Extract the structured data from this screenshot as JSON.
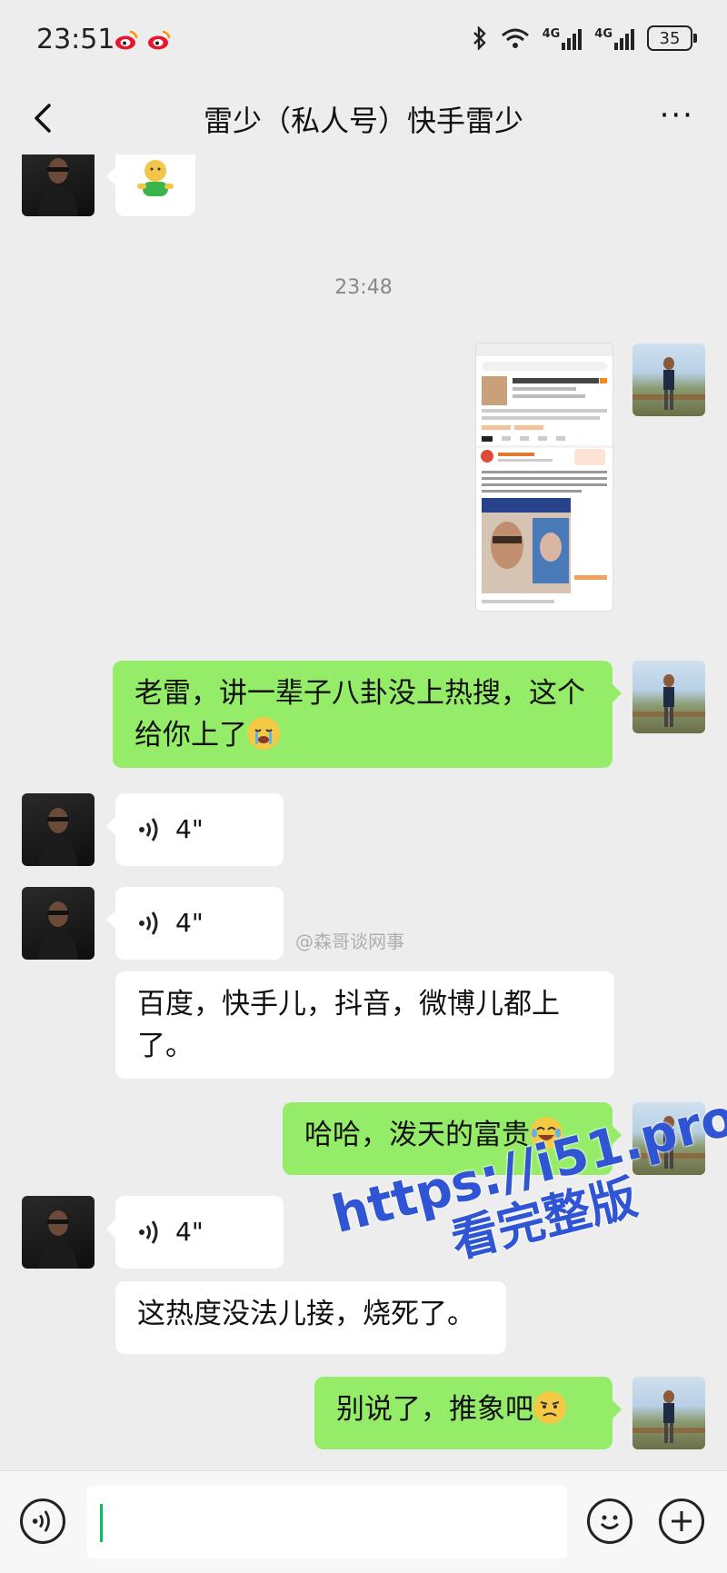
{
  "status_bar": {
    "time": "23:51",
    "network_1": "4G",
    "network_2": "4G",
    "battery": "35"
  },
  "header": {
    "title": "雷少（私人号）快手雷少",
    "more_label": "···"
  },
  "chat": {
    "timestamp": "23:48",
    "messages": [
      {
        "side": "left",
        "type": "emoji"
      },
      {
        "side": "right",
        "type": "image"
      },
      {
        "side": "right",
        "type": "text",
        "text": "老雷，讲一辈子八卦没上热搜，这个给你上了"
      },
      {
        "side": "left",
        "type": "voice",
        "duration": "4\""
      },
      {
        "side": "left",
        "type": "voice",
        "duration": "4\""
      },
      {
        "side": "left",
        "type": "text",
        "text": "百度，快手儿，抖音，微博儿都上了。"
      },
      {
        "side": "right",
        "type": "text",
        "text": "哈哈，泼天的富贵"
      },
      {
        "side": "left",
        "type": "voice",
        "duration": "4\""
      },
      {
        "side": "left",
        "type": "text",
        "text": "这热度没法儿接，烧死了。"
      },
      {
        "side": "right",
        "type": "text",
        "text": "别说了，推象吧"
      }
    ],
    "watermark": "@森哥谈网事",
    "promo_line1": "https://i51.pro",
    "promo_line2": "看完整版"
  },
  "input_bar": {
    "voice_icon": "voice-mode-icon",
    "emoji_icon": "emoji-icon",
    "add_icon": "plus-icon"
  },
  "colors": {
    "chat_bg": "#ededed",
    "bubble_self": "#95ec69",
    "bubble_other": "#ffffff",
    "accent": "#07c160",
    "promo": "#2f55d4"
  }
}
